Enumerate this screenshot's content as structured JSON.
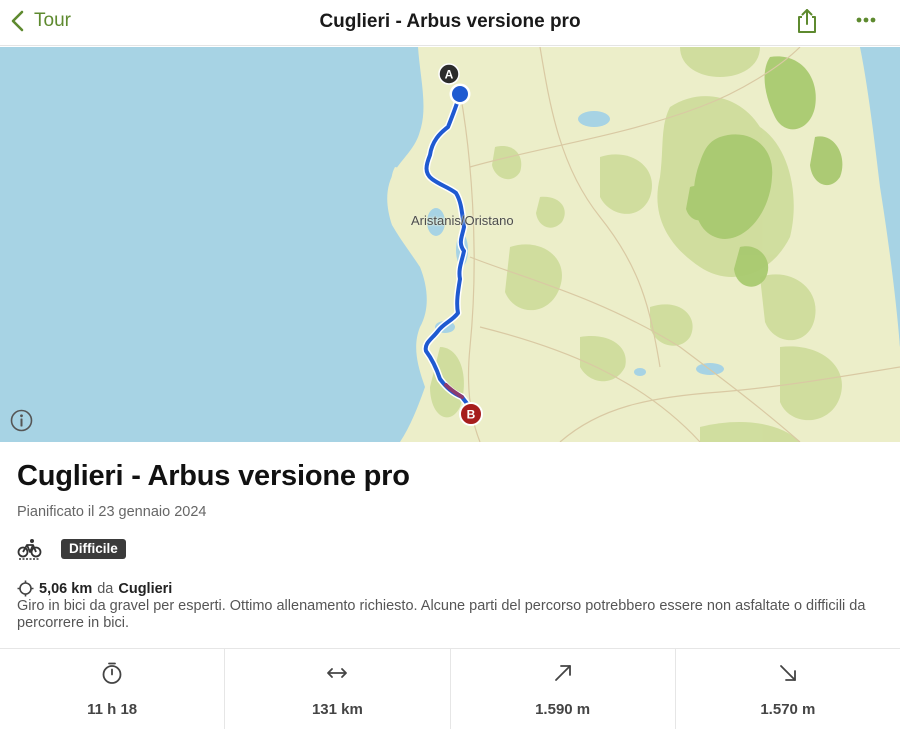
{
  "nav": {
    "back_label": "Tour",
    "title": "Cuglieri - Arbus versione pro",
    "accent_color": "#5e8a2f"
  },
  "map": {
    "place_label": "Aristanis/Oristano",
    "start_marker": "A",
    "end_marker": "B",
    "route_color": "#1f5ad1"
  },
  "route": {
    "title": "Cuglieri - Arbus versione pro",
    "planned": "Pianificato il 23 gennaio 2024",
    "sport_icon": "bicycle-icon",
    "difficulty": "Difficile",
    "distance": "5,06 km",
    "distance_prep": "da",
    "distance_place": "Cuglieri",
    "description": "Giro in bici da gravel per esperti. Ottimo allenamento richiesto. Alcune parti del percorso potrebbero essere non asfaltate o difficili da percorrere in bici."
  },
  "stats": [
    {
      "icon": "stopwatch-icon",
      "value": "11 h 18"
    },
    {
      "icon": "horizontal-arrows-icon",
      "value": "131 km"
    },
    {
      "icon": "arrow-up-right-icon",
      "value": "1.590 m"
    },
    {
      "icon": "arrow-down-right-icon",
      "value": "1.570 m"
    }
  ]
}
